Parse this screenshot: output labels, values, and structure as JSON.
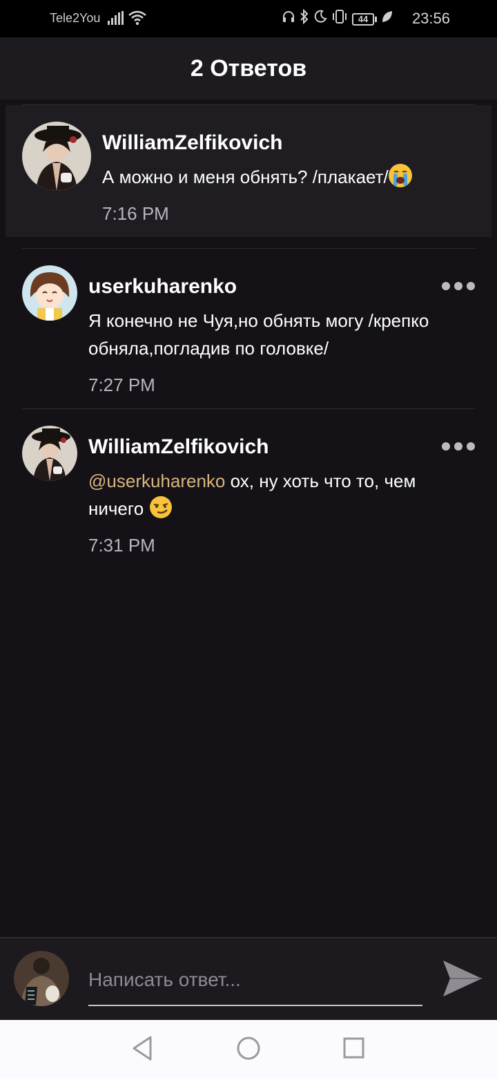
{
  "status_bar": {
    "carrier": "Tele2You",
    "battery": "44",
    "time": "23:56",
    "icons": [
      "signal-icon",
      "wifi-icon",
      "headphones-icon",
      "bluetooth-icon",
      "moon-icon",
      "vibrate-icon",
      "battery-icon",
      "leaf-icon"
    ]
  },
  "header": {
    "title": "2 Ответов"
  },
  "parent_comment": {
    "author": "WilliamZelfikovich",
    "text": "А можно и меня обнять? /плакает/",
    "emoji": "crying-face-emoji",
    "time": "7:16 PM"
  },
  "replies": [
    {
      "author": "userkuharenko",
      "text": "Я конечно не Чуя,но обнять могу /крепко обняла,погладив по головке/",
      "time": "7:27 PM"
    },
    {
      "author": "WilliamZelfikovich",
      "mention": "@userkuharenko",
      "text": " ох, ну хоть что то, чем ничего",
      "emoji": "smirking-face-emoji",
      "time": "7:31 PM"
    }
  ],
  "composer": {
    "placeholder": "Написать ответ..."
  },
  "colors": {
    "background": "#141216",
    "header": "#1d1b20",
    "mention": "#d9b57f",
    "timestamp": "#b8b6bd"
  }
}
